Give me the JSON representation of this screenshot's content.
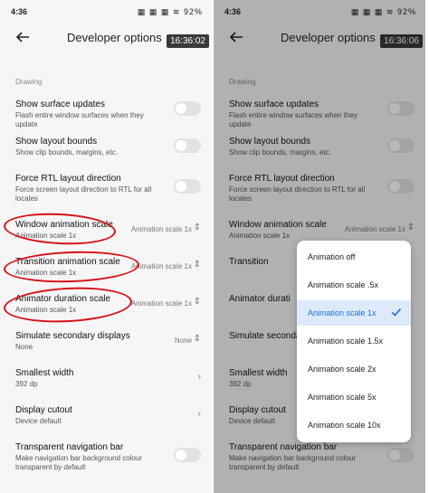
{
  "status_left": {
    "time": "4:36",
    "icons": "⊙ ✉ · ",
    "right": "▦ ▦ ▦ ≋ 92%"
  },
  "status_right": {
    "time": "4:36",
    "icons": "⊙ ✉ · ",
    "right": "▦ ▦ ▦ ≋ 92%"
  },
  "header": {
    "title": "Developer options",
    "timestamp_left": "16:36:02",
    "timestamp_right": "16:36:06"
  },
  "section": "Drawing",
  "rows": {
    "surface": {
      "title": "Show surface updates",
      "sub": "Flash entire window surfaces when they update"
    },
    "layout": {
      "title": "Show layout bounds",
      "sub": "Show clip bounds, margins, etc."
    },
    "rtl": {
      "title": "Force RTL layout direction",
      "sub": "Force screen layout direction to RTL for all locales"
    },
    "window": {
      "title": "Window animation scale",
      "sub": "Animation scale 1x",
      "value": "Animation scale 1x"
    },
    "transition": {
      "title": "Transition animation scale",
      "sub": "Animation scale 1x",
      "value": "Animation scale 1x"
    },
    "animator": {
      "title": "Animator duration scale",
      "sub": "Animation scale 1x",
      "value": "Animation scale 1x"
    },
    "secondary": {
      "title": "Simulate secondary displays",
      "sub": "None",
      "value": "None"
    },
    "smallest": {
      "title": "Smallest width",
      "sub": "392 dp"
    },
    "cutout": {
      "title": "Display cutout",
      "sub": "Device default"
    },
    "navbar": {
      "title": "Transparent navigation bar",
      "sub": "Make navigation bar background colour transparent by default"
    }
  },
  "right_rows": {
    "window_partial": "Window animation scale",
    "transition_partial": "Transition",
    "animator_partial": "Animator durati",
    "secondary_partial": "Simulate seconda",
    "smallest_partial": "Smallest width",
    "cutout_partial": "Display cutout",
    "navbar_partial": "Transparent navigation bar",
    "navbar_sub_partial": "Make navigation bar background colour transparent by default"
  },
  "dropdown": {
    "options": [
      "Animation off",
      "Animation scale .5x",
      "Animation scale 1x",
      "Animation scale 1.5x",
      "Animation scale 2x",
      "Animation scale 5x",
      "Animation scale 10x"
    ],
    "selected_index": 2
  },
  "colors": {
    "accent": "#1a6fe0",
    "annotation": "#d51019"
  }
}
